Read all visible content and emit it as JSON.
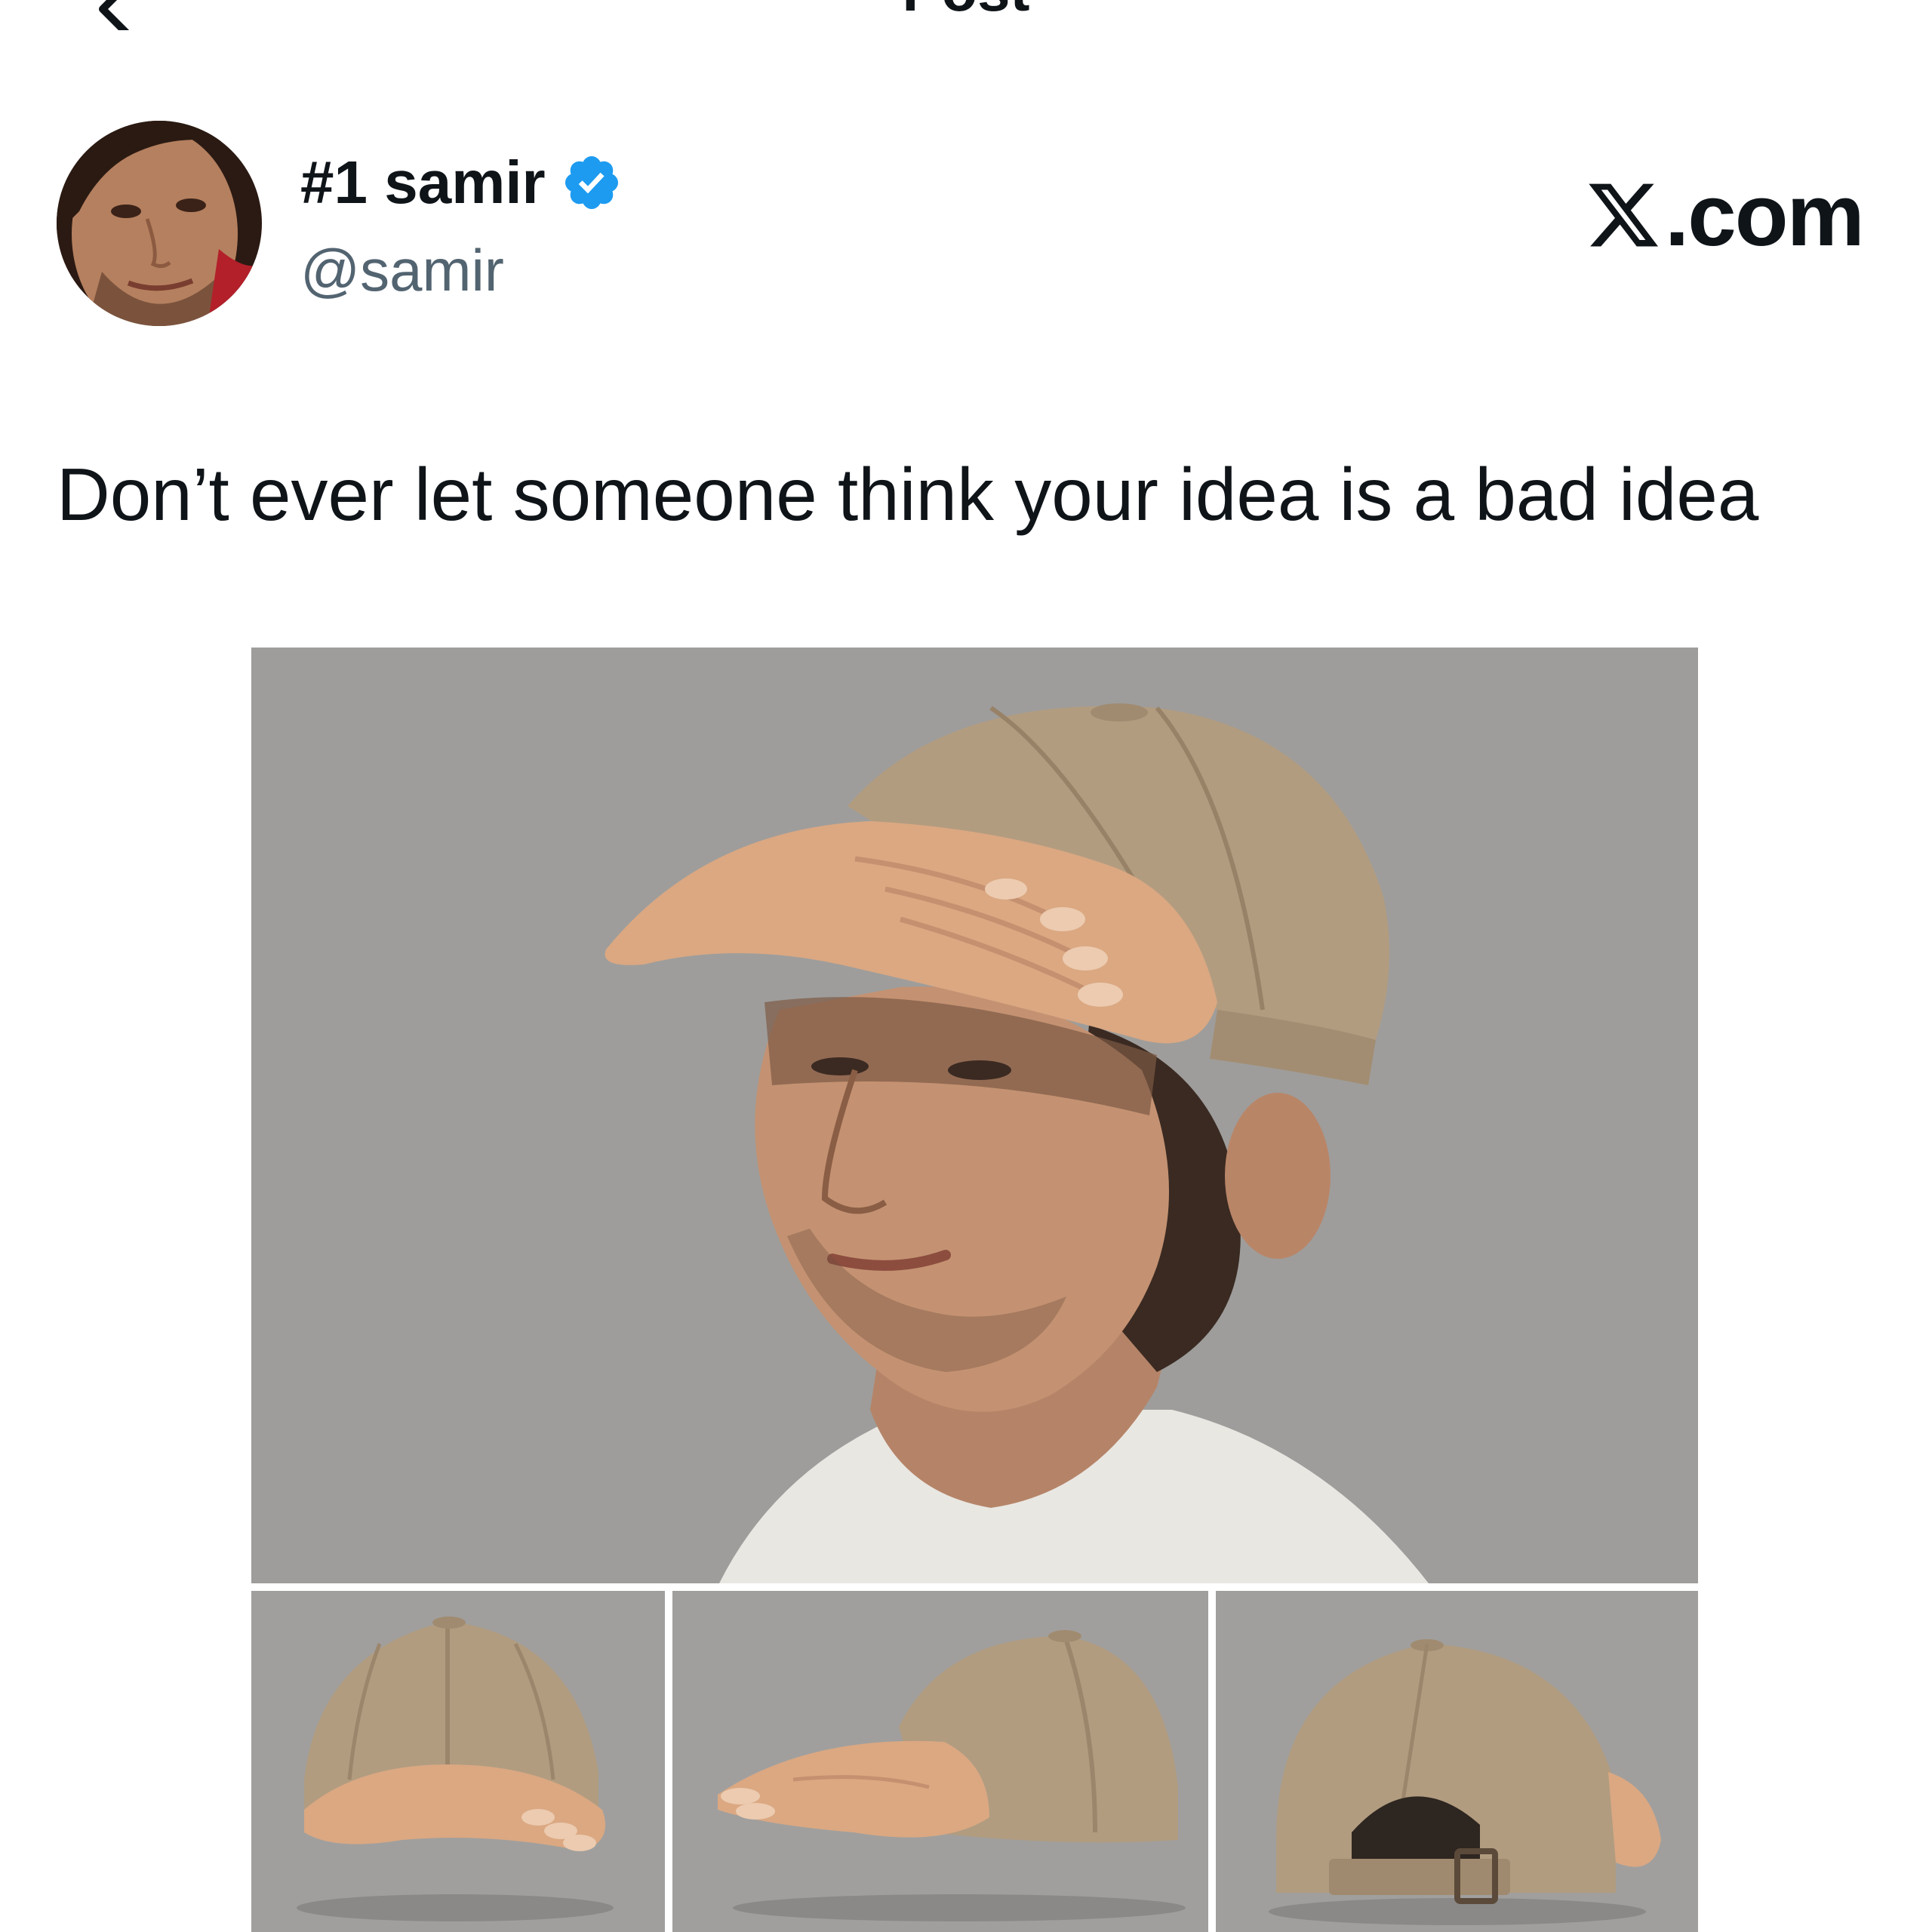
{
  "header": {
    "title": "Post",
    "back_icon": "arrow-left-icon"
  },
  "author": {
    "display_name": "#1 samir",
    "handle": "@samir",
    "verified": true,
    "verified_color": "#1d9bf0"
  },
  "watermark": {
    "text": ".com",
    "logo_icon": "x-logo-icon"
  },
  "post": {
    "text": "Don’t ever let someone think your idea is a bad idea"
  },
  "media": {
    "count": 4,
    "items": [
      "photo-man-wearing-hand-brim-cap",
      "photo-cap-front-view",
      "photo-cap-side-view",
      "photo-cap-back-view"
    ]
  },
  "colors": {
    "text": "#0f1419",
    "secondary_text": "#536471",
    "background": "#ffffff",
    "photo_background": "#9d9c9a"
  }
}
